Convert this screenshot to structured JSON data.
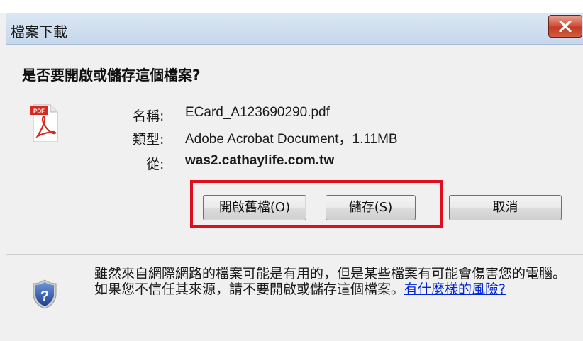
{
  "dialog": {
    "title": "檔案下載",
    "question": "是否要開啟或儲存這個檔案?"
  },
  "file": {
    "icon": "pdf-file-icon",
    "name_label": "名稱:",
    "name_value": "ECard_A123690290.pdf",
    "type_label": "類型:",
    "type_value": "Adobe Acrobat Document，1.11MB",
    "from_label": "從:",
    "from_value": "was2.cathaylife.com.tw"
  },
  "buttons": {
    "open": "開啟舊檔(O)",
    "save": "儲存(S)",
    "cancel": "取消"
  },
  "warning": {
    "icon": "security-shield-question-icon",
    "text": "雖然來自網際網路的檔案可能是有用的，但是某些檔案有可能會傷害您的電腦。如果您不信任其來源，請不要開啟或儲存這個檔案。",
    "link": "有什麼樣的風險?"
  },
  "colors": {
    "highlight_box": "#e10d1e",
    "link": "#0026d8",
    "close_button": "#c9452d"
  }
}
